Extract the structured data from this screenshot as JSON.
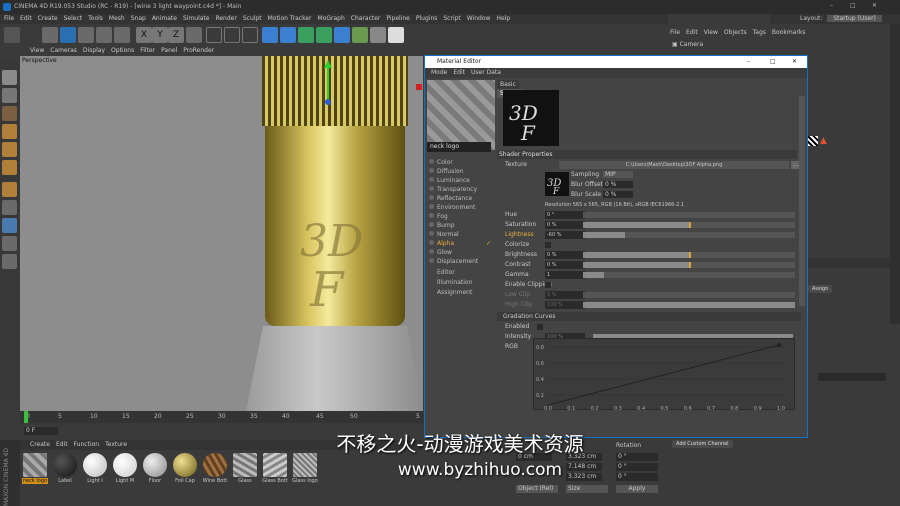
{
  "window": {
    "title": "CINEMA 4D R19.053 Studio (RC - R19) - [wine 3 light waypoint.c4d *] - Main",
    "layout_label": "Layout:",
    "layout_value": "Startup (User)"
  },
  "menu": [
    "File",
    "Edit",
    "Create",
    "Select",
    "Tools",
    "Mesh",
    "Snap",
    "Animate",
    "Simulate",
    "Render",
    "Sculpt",
    "Motion Tracker",
    "MoGraph",
    "Character",
    "Pipeline",
    "Plugins",
    "Script",
    "Window",
    "Help"
  ],
  "viewport_menu": [
    "View",
    "Cameras",
    "Display",
    "Options",
    "Filter",
    "Panel",
    "ProRender"
  ],
  "viewport_label": "Perspective",
  "timeline": {
    "ticks": [
      "0",
      "5",
      "10",
      "15",
      "20",
      "25",
      "30",
      "35",
      "40",
      "45",
      "50",
      "5"
    ],
    "start_frame": "0 F",
    "current": "0 F"
  },
  "material_bar": [
    "Create",
    "Edit",
    "Function",
    "Texture"
  ],
  "materials": [
    {
      "label": "neck logo",
      "color": "#888"
    },
    {
      "label": "Label",
      "color": "#111"
    },
    {
      "label": "Light I",
      "color": "#e8e8e8"
    },
    {
      "label": "Light M",
      "color": "#f0f0f0"
    },
    {
      "label": "Floor",
      "color": "#bdbdbd"
    },
    {
      "label": "Foil Cap",
      "color": "#b8a03a"
    },
    {
      "label": "Wine Bott",
      "color": "#7a5a30"
    },
    {
      "label": "Glass",
      "color": "#9a9a9a"
    },
    {
      "label": "Glass Bott",
      "color": "#aaa"
    },
    {
      "label": "Glass logo",
      "color": "#999"
    }
  ],
  "editor": {
    "title": "Material Editor",
    "menu": [
      "Mode",
      "Edit",
      "User Data"
    ],
    "material_name": "neck logo",
    "channels": [
      "Color",
      "Diffusion",
      "Luminance",
      "Transparency",
      "Reflectance",
      "Environment",
      "Fog",
      "Bump",
      "Normal",
      "Alpha",
      "Glow",
      "Displacement",
      "Editor",
      "Illumination",
      "Assignment"
    ],
    "tabs": [
      "Basic",
      "Shader"
    ],
    "section": "Shader Properties",
    "texture_label": "Texture",
    "texture_path": "C:\\Users\\Mash\\Desktop\\3DF Alpha.png",
    "sampling_label": "Sampling",
    "sampling_value": "MIP",
    "bluroffset_label": "Blur Offset",
    "bluroffset_value": "0 %",
    "blurscale_label": "Blur Scale",
    "blurscale_value": "0 %",
    "resolution": "Resolution 565 x 565, RGB (16 Bit), sRGB IEC61966-2.1",
    "params": [
      {
        "label": "Hue",
        "value": "0 °",
        "level": 0
      },
      {
        "label": "Saturation",
        "value": "0 %",
        "level": 0.5
      },
      {
        "label": "Lightness",
        "value": "-60 %",
        "level": 0.2
      },
      {
        "label": "Colorize",
        "value": "",
        "level": null
      },
      {
        "label": "Brightness",
        "value": "0 %",
        "level": 0.5
      },
      {
        "label": "Contrast",
        "value": "0 %",
        "level": 0.5
      },
      {
        "label": "Gamma",
        "value": "1",
        "level": 0.1
      },
      {
        "label": "Enable Clipping",
        "value": "",
        "level": null
      },
      {
        "label": "Low Clip",
        "value": "0 %",
        "level": 0
      },
      {
        "label": "High Clip",
        "value": "100 %",
        "level": 1
      }
    ],
    "gradation": "Gradation Curves",
    "enabled_label": "Enabled",
    "intensity_label": "Intensity",
    "intensity_value": "100 %",
    "rgb_label": "RGB",
    "curve_y": [
      "0.8",
      "0.6",
      "0.4",
      "0.2"
    ],
    "curve_x": [
      "0.0",
      "0.1",
      "0.2",
      "0.3",
      "0.4",
      "0.5",
      "0.6",
      "0.7",
      "0.8",
      "0.9",
      "1.0"
    ]
  },
  "object_manager": {
    "menu": [
      "File",
      "Edit",
      "View",
      "Objects",
      "Tags",
      "Bookmarks"
    ],
    "item": "Camera"
  },
  "assign_button": "Assign",
  "add_channel": "Add Custom Channel",
  "coords": {
    "header": "Rotation",
    "x": "0 cm",
    "x2": "3.323 cm",
    "y2": "7.148 cm",
    "z2": "3.323 cm",
    "h": "0 °",
    "p": "0 °",
    "b": "0 °",
    "object": "Object (Rel)",
    "size": "Size",
    "apply": "Apply"
  },
  "watermark": "不移之火-动漫游戏美术资源",
  "watermark_url": "www.byzhihuo.com",
  "logo": "MAXON CINEMA 4D"
}
